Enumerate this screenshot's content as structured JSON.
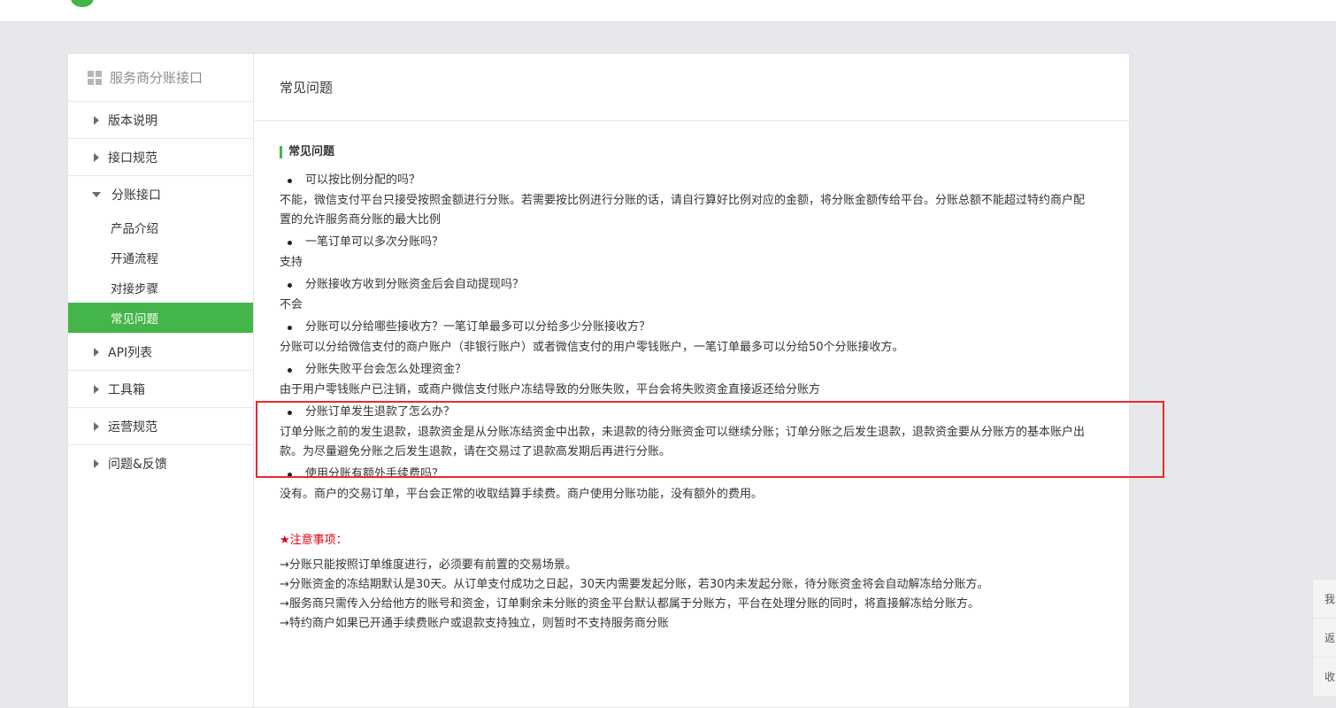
{
  "sidebar": {
    "header": "服务商分账接口",
    "items": [
      {
        "label": "版本说明"
      },
      {
        "label": "接口规范"
      },
      {
        "label": "分账接口"
      },
      {
        "label": "API列表"
      },
      {
        "label": "工具箱"
      },
      {
        "label": "运营规范"
      },
      {
        "label": "问题&反馈"
      }
    ],
    "subitems": [
      {
        "label": "产品介绍"
      },
      {
        "label": "开通流程"
      },
      {
        "label": "对接步骤"
      },
      {
        "label": "常见问题"
      }
    ],
    "active_color": "#44b549"
  },
  "main": {
    "page_title": "常见问题",
    "section_title": "常见问题",
    "faqs": [
      {
        "q": "可以按比例分配的吗？",
        "a": "不能，微信支付平台只接受按照金额进行分账。若需要按比例进行分账的话，请自行算好比例对应的金额，将分账金额传给平台。分账总额不能超过特约商户配置的允许服务商分账的最大比例"
      },
      {
        "q": "一笔订单可以多次分账吗？",
        "a": "支持"
      },
      {
        "q": "分账接收方收到分账资金后会自动提现吗？",
        "a": "不会"
      },
      {
        "q": "分账可以分给哪些接收方？一笔订单最多可以分给多少分账接收方？",
        "a": "分账可以分给微信支付的商户账户（非银行账户）或者微信支付的用户零钱账户，一笔订单最多可以分给50个分账接收方。"
      },
      {
        "q": "分账失败平台会怎么处理资金？",
        "a": "由于用户零钱账户已注销，或商户微信支付账户冻结导致的分账失败，平台会将失败资金直接返还给分账方"
      },
      {
        "q": "分账订单发生退款了怎么办？",
        "a": "订单分账之前的发生退款，退款资金是从分账冻结资金中出款，未退款的待分账资金可以继续分账；订单分账之后发生退款，退款资金要从分账方的基本账户出款。为尽量避免分账之后发生退款，请在交易过了退款高发期后再进行分账。"
      },
      {
        "q": "使用分账有额外手续费吗？",
        "a": "没有。商户的交易订单，平台会正常的收取结算手续费。商户使用分账功能，没有额外的费用。"
      }
    ],
    "notes_title": "★注意事项：",
    "notes": [
      "→分账只能按照订单维度进行，必须要有前置的交易场景。",
      "→分账资金的冻结期默认是30天。从订单支付成功之日起，30天内需要发起分账，若30内未发起分账，待分账资金将会自动解冻给分账方。",
      "→服务商只需传入分给他方的账号和资金，订单剩余未分账的资金平台默认都属于分账方，平台在处理分账的同时，将直接解冻给分账方。",
      "→特约商户如果已开通手续费账户或退款支持独立，则暂时不支持服务商分账"
    ],
    "notes_color": "#e0000c"
  },
  "highlight": {
    "color": "#e8292f"
  },
  "side_float": [
    "我",
    "返",
    "收"
  ]
}
